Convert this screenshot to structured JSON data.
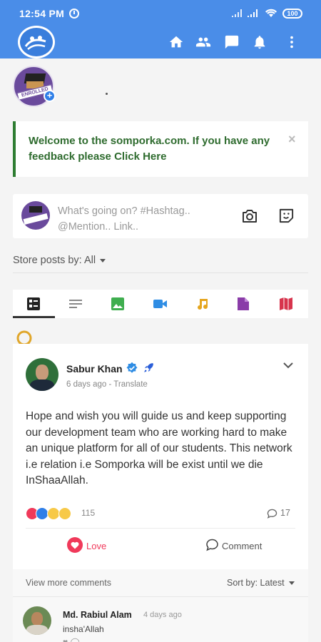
{
  "status_bar": {
    "time": "12:54 PM",
    "battery": "100"
  },
  "app_bar": {
    "logo": "somporka-logo",
    "icons": [
      "home-icon",
      "friends-icon",
      "messages-icon",
      "notifications-icon",
      "more-vert-icon"
    ]
  },
  "profile": {
    "avatar_badge": "ENROLLED"
  },
  "alert": {
    "text": "Welcome to the somporka.com. If you have any feedback please",
    "link": "Click Here",
    "close": "×",
    "accent_color": "#2e7d32"
  },
  "composer": {
    "placeholder": "What's going on? #Hashtag.. @Mention.. Link.."
  },
  "store": {
    "label": "Store posts by: All"
  },
  "filter_tabs": [
    "all-posts-icon",
    "text-icon",
    "photo-icon",
    "video-icon",
    "music-icon",
    "file-icon",
    "map-icon"
  ],
  "post": {
    "author": "Sabur Khan",
    "meta": "6 days ago - Translate",
    "body": "Hope and wish you will guide us and keep supporting our development team who are working hard to make an unique platform for all of our students. This network i.e relation i.e Somporka will be exist until we die InShaaAllah.",
    "reaction_count": "115",
    "comment_count": "17",
    "love_label": "Love",
    "comment_label": "Comment",
    "love_color": "#f0395a"
  },
  "comments": {
    "view_more": "View more comments",
    "sort_by": "Sort by: Latest",
    "items": [
      {
        "name": "Md. Rabiul Alam",
        "time": "4 days ago",
        "text": "insha'Allah"
      }
    ]
  },
  "colors": {
    "app_bar": "#4a8de8",
    "accent_blue": "#2f7fe8"
  }
}
